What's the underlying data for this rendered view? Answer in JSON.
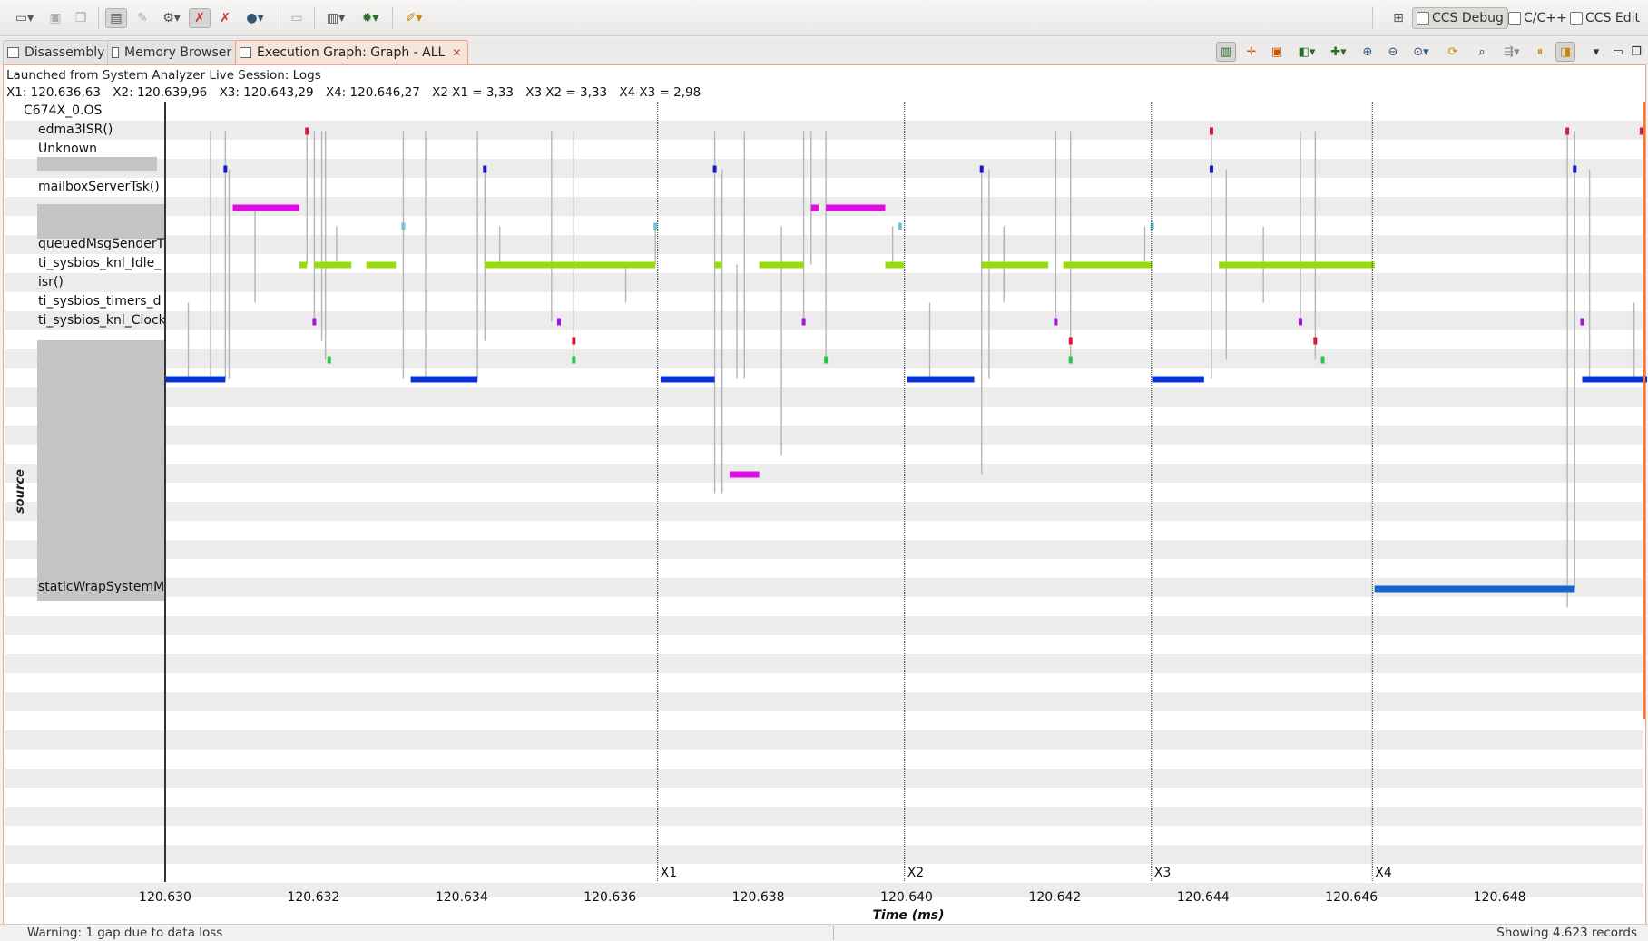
{
  "perspectives": [
    {
      "label": "CCS Debug",
      "active": true
    },
    {
      "label": "C/C++",
      "active": false
    },
    {
      "label": "CCS Edit",
      "active": false
    }
  ],
  "tabs": [
    {
      "label": "Disassembly",
      "icon": "disassembly-icon",
      "active": false
    },
    {
      "label": "Memory Browser",
      "icon": "memory-icon",
      "active": false
    },
    {
      "label": "Execution Graph: Graph - ALL",
      "icon": "graph-icon",
      "active": true
    }
  ],
  "info": {
    "launch": "Launched from System Analyzer Live Session: Logs",
    "markers": [
      "X1: 120.636,63",
      "X2: 120.639,96",
      "X3: 120.643,29",
      "X4: 120.646,27",
      "X2-X1 = 3,33",
      "X3-X2 = 3,33",
      "X4-X3 = 2,98"
    ]
  },
  "rows": [
    {
      "label": "C674X_0.OS",
      "indent": 1
    },
    {
      "label": "edma3ISR()",
      "indent": 2
    },
    {
      "label": "Unknown",
      "indent": 2
    },
    {
      "label": "",
      "indent": 2
    },
    {
      "label": "mailboxServerTsk()",
      "indent": 2
    },
    {
      "label": "",
      "indent": 2
    },
    {
      "label": "",
      "indent": 2
    },
    {
      "label": "queuedMsgSenderT",
      "indent": 2
    },
    {
      "label": "ti_sysbios_knl_Idle_",
      "indent": 2
    },
    {
      "label": "isr()",
      "indent": 2
    },
    {
      "label": "ti_sysbios_timers_d",
      "indent": 2
    },
    {
      "label": "ti_sysbios_knl_Clock",
      "indent": 2
    },
    {
      "label": "",
      "indent": 2
    },
    {
      "label": "",
      "indent": 2
    },
    {
      "label": "",
      "indent": 2
    },
    {
      "label": "",
      "indent": 2
    },
    {
      "label": "",
      "indent": 2
    },
    {
      "label": "",
      "indent": 2
    },
    {
      "label": "",
      "indent": 2
    },
    {
      "label": "",
      "indent": 2
    },
    {
      "label": "",
      "indent": 2
    },
    {
      "label": "",
      "indent": 2
    },
    {
      "label": "",
      "indent": 2
    },
    {
      "label": "",
      "indent": 2
    },
    {
      "label": "",
      "indent": 2
    },
    {
      "label": "staticWrapSystemM",
      "indent": 2
    }
  ],
  "y_axis_label": "source",
  "axis": {
    "title": "Time  (ms)",
    "ticks": [
      "120.630",
      "120.632",
      "120.634",
      "120.636",
      "120.638",
      "120.640",
      "120.642",
      "120.644",
      "120.646",
      "120.648"
    ]
  },
  "cursors": [
    {
      "name": "X1",
      "t": 120.63663
    },
    {
      "name": "X2",
      "t": 120.63996
    },
    {
      "name": "X3",
      "t": 120.64329
    },
    {
      "name": "X4",
      "t": 120.64627
    }
  ],
  "chart_data": {
    "type": "bar",
    "x_range": [
      120.63,
      120.65
    ],
    "segments": [
      {
        "row": 14,
        "start": 120.63,
        "end": 120.6308,
        "color": "#0b32d4"
      },
      {
        "row": 14,
        "start": 120.6333,
        "end": 120.6342,
        "color": "#0b32d4"
      },
      {
        "row": 14,
        "start": 120.63667,
        "end": 120.6374,
        "color": "#0b32d4"
      },
      {
        "row": 14,
        "start": 120.64,
        "end": 120.6409,
        "color": "#0b32d4"
      },
      {
        "row": 14,
        "start": 120.6433,
        "end": 120.644,
        "color": "#0b32d4"
      },
      {
        "row": 14,
        "start": 120.6491,
        "end": 120.65,
        "color": "#0b32d4"
      },
      {
        "row": 5,
        "start": 120.6309,
        "end": 120.6318,
        "color": "#e10de6"
      },
      {
        "row": 5,
        "start": 120.6387,
        "end": 120.6388,
        "color": "#e10de6"
      },
      {
        "row": 5,
        "start": 120.6389,
        "end": 120.6397,
        "color": "#e10de6"
      },
      {
        "row": 19,
        "start": 120.6376,
        "end": 120.638,
        "color": "#e10de6"
      },
      {
        "row": 8,
        "start": 120.6318,
        "end": 120.6319,
        "color": "#96dc0c"
      },
      {
        "row": 8,
        "start": 120.632,
        "end": 120.6325,
        "color": "#96dc0c"
      },
      {
        "row": 8,
        "start": 120.6327,
        "end": 120.6331,
        "color": "#96dc0c"
      },
      {
        "row": 8,
        "start": 120.6343,
        "end": 120.6366,
        "color": "#96dc0c"
      },
      {
        "row": 8,
        "start": 120.6374,
        "end": 120.6375,
        "color": "#96dc0c"
      },
      {
        "row": 8,
        "start": 120.638,
        "end": 120.6386,
        "color": "#96dc0c"
      },
      {
        "row": 8,
        "start": 120.6397,
        "end": 120.63995,
        "color": "#96dc0c"
      },
      {
        "row": 8,
        "start": 120.641,
        "end": 120.6419,
        "color": "#96dc0c"
      },
      {
        "row": 8,
        "start": 120.6421,
        "end": 120.6433,
        "color": "#96dc0c"
      },
      {
        "row": 8,
        "start": 120.6442,
        "end": 120.6463,
        "color": "#96dc0c"
      },
      {
        "row": 25,
        "start": 120.6463,
        "end": 120.649,
        "color": "#1464d2"
      }
    ],
    "markers": [
      {
        "row": 1,
        "t": 120.6319,
        "color": "#d61a3c"
      },
      {
        "row": 1,
        "t": 120.6441,
        "color": "#d61a3c"
      },
      {
        "row": 1,
        "t": 120.6489,
        "color": "#d61a3c"
      },
      {
        "row": 1,
        "t": 120.6499,
        "color": "#d61a3c"
      },
      {
        "row": 3,
        "t": 120.6308,
        "color": "#1818c8"
      },
      {
        "row": 3,
        "t": 120.6343,
        "color": "#1818c8"
      },
      {
        "row": 3,
        "t": 120.6374,
        "color": "#1818c8"
      },
      {
        "row": 3,
        "t": 120.641,
        "color": "#1818c8"
      },
      {
        "row": 3,
        "t": 120.6441,
        "color": "#1818c8"
      },
      {
        "row": 3,
        "t": 120.649,
        "color": "#1818c8"
      },
      {
        "row": 6,
        "t": 120.6332,
        "color": "#6ac7d4"
      },
      {
        "row": 6,
        "t": 120.6366,
        "color": "#6ac7d4"
      },
      {
        "row": 6,
        "t": 120.6399,
        "color": "#6ac7d4"
      },
      {
        "row": 6,
        "t": 120.6433,
        "color": "#6ac7d4"
      },
      {
        "row": 11,
        "t": 120.632,
        "color": "#a218d2"
      },
      {
        "row": 11,
        "t": 120.6353,
        "color": "#a218d2"
      },
      {
        "row": 11,
        "t": 120.6386,
        "color": "#a218d2"
      },
      {
        "row": 11,
        "t": 120.642,
        "color": "#a218d2"
      },
      {
        "row": 11,
        "t": 120.6453,
        "color": "#a218d2"
      },
      {
        "row": 11,
        "t": 120.6491,
        "color": "#a218d2"
      },
      {
        "row": 12,
        "t": 120.6355,
        "color": "#d61a3c"
      },
      {
        "row": 12,
        "t": 120.6422,
        "color": "#d61a3c"
      },
      {
        "row": 12,
        "t": 120.6455,
        "color": "#d61a3c"
      },
      {
        "row": 13,
        "t": 120.6322,
        "color": "#2cc24a"
      },
      {
        "row": 13,
        "t": 120.6355,
        "color": "#2cc24a"
      },
      {
        "row": 13,
        "t": 120.6389,
        "color": "#2cc24a"
      },
      {
        "row": 13,
        "t": 120.6422,
        "color": "#2cc24a"
      },
      {
        "row": 13,
        "t": 120.6456,
        "color": "#2cc24a"
      }
    ],
    "transitions": [
      [
        120.6303,
        10,
        14
      ],
      [
        120.6306,
        1,
        14
      ],
      [
        120.6308,
        1,
        14
      ],
      [
        120.63085,
        3,
        14
      ],
      [
        120.6312,
        5,
        10
      ],
      [
        120.6319,
        1,
        8
      ],
      [
        120.632,
        1,
        11
      ],
      [
        120.6321,
        1,
        12
      ],
      [
        120.63215,
        1,
        13
      ],
      [
        120.6323,
        6,
        8
      ],
      [
        120.6332,
        1,
        14
      ],
      [
        120.6335,
        1,
        14
      ],
      [
        120.6342,
        1,
        14
      ],
      [
        120.6343,
        3,
        12
      ],
      [
        120.6345,
        6,
        8
      ],
      [
        120.6352,
        1,
        11
      ],
      [
        120.6355,
        1,
        13
      ],
      [
        120.6362,
        8,
        10
      ],
      [
        120.6366,
        6,
        8
      ],
      [
        120.6374,
        1,
        20
      ],
      [
        120.6375,
        3,
        20
      ],
      [
        120.6377,
        8,
        14
      ],
      [
        120.6378,
        1,
        14
      ],
      [
        120.6383,
        6,
        18
      ],
      [
        120.6386,
        1,
        11
      ],
      [
        120.6387,
        1,
        8
      ],
      [
        120.6389,
        1,
        13
      ],
      [
        120.6398,
        6,
        8
      ],
      [
        120.6403,
        10,
        14
      ],
      [
        120.641,
        3,
        19
      ],
      [
        120.6411,
        3,
        14
      ],
      [
        120.6413,
        6,
        10
      ],
      [
        120.642,
        1,
        11
      ],
      [
        120.6422,
        1,
        13
      ],
      [
        120.6432,
        6,
        8
      ],
      [
        120.6441,
        1,
        14
      ],
      [
        120.6443,
        3,
        13
      ],
      [
        120.6448,
        6,
        10
      ],
      [
        120.6453,
        1,
        11
      ],
      [
        120.6455,
        1,
        13
      ],
      [
        120.6489,
        1,
        26
      ],
      [
        120.649,
        1,
        25
      ],
      [
        120.6492,
        3,
        14
      ],
      [
        120.6498,
        10,
        14
      ]
    ]
  }
}
